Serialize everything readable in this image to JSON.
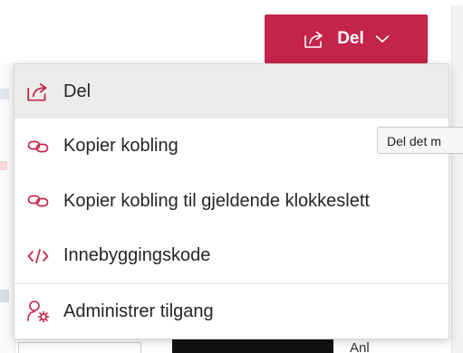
{
  "share_button": {
    "label": "Del",
    "icon": "share-arrow-icon",
    "dropdown_icon": "chevron-down-icon",
    "color": "#c4234a"
  },
  "menu": {
    "items": [
      {
        "label": "Del",
        "icon": "share-arrow-icon"
      },
      {
        "label": "Kopier kobling",
        "icon": "link-icon"
      },
      {
        "label": "Kopier kobling til gjeldende klokkeslett",
        "icon": "link-icon"
      },
      {
        "label": "Innebyggingskode",
        "icon": "code-icon"
      },
      {
        "label": "Administrer tilgang",
        "icon": "manage-access-icon"
      }
    ]
  },
  "tooltip": {
    "text": "Del det m"
  },
  "background": {
    "bottom_fragment": "Anl"
  }
}
